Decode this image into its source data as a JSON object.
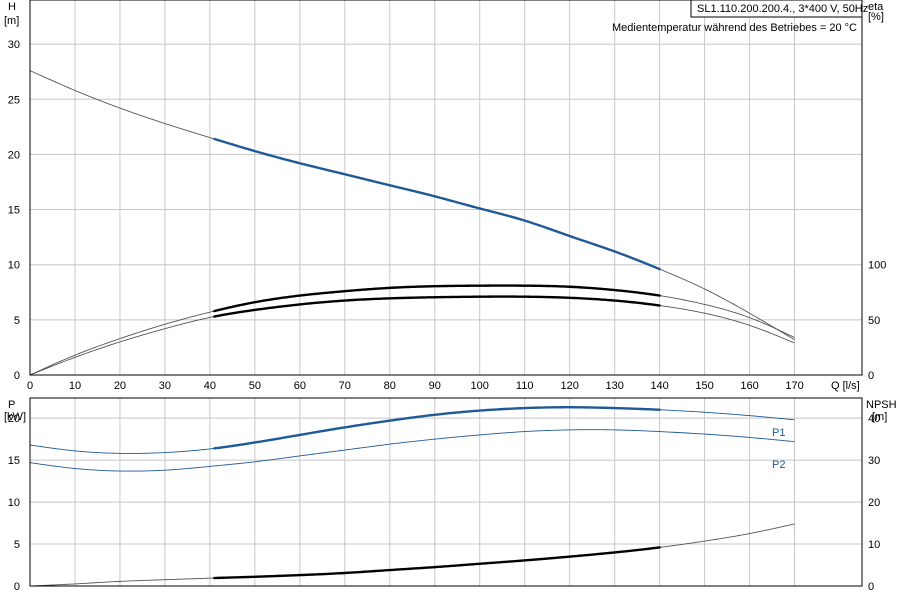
{
  "colors": {
    "blue": "#1f5a96",
    "black": "#000000",
    "thin": "#555555",
    "grid": "#c8c8c8"
  },
  "header": {
    "model": "SL1.110.200.200.4., 3*400 V, 50Hz",
    "temperature_note": "Medientemperatur während des Betriebes = 20 °C"
  },
  "chart_data": [
    {
      "type": "line",
      "panel": "top",
      "y_left_label": "H",
      "y_left_unit": "[m]",
      "y_right_label": "eta",
      "y_right_unit": "[%]",
      "x_label": "Q [l/s]",
      "xlim": [
        0,
        185
      ],
      "x_ticks": [
        0,
        10,
        20,
        30,
        40,
        50,
        60,
        70,
        80,
        90,
        100,
        110,
        120,
        130,
        140,
        150,
        160,
        170
      ],
      "ylim_left": [
        0,
        34
      ],
      "y_left_ticks": [
        0,
        5,
        10,
        15,
        20,
        25,
        30
      ],
      "ylim_right": [
        0,
        340
      ],
      "y_right_ticks": [
        0,
        50,
        100
      ],
      "grid": true,
      "series": [
        {
          "role": "H",
          "axis": "left",
          "style": "thin",
          "x": [
            0,
            10,
            20,
            30,
            41,
            50,
            60,
            70,
            80,
            90,
            100,
            110,
            120,
            130,
            140,
            150,
            160,
            170
          ],
          "y": [
            27.6,
            25.8,
            24.2,
            22.8,
            21.4,
            20.3,
            19.2,
            18.2,
            17.2,
            16.2,
            15.1,
            14.0,
            12.6,
            11.2,
            9.6,
            7.8,
            5.6,
            3.2
          ]
        },
        {
          "role": "H",
          "axis": "left",
          "style": "bold-blue",
          "x_start": 41,
          "x_end": 140
        },
        {
          "role": "eta-upper",
          "axis": "left",
          "style": "thin",
          "x": [
            0,
            10,
            20,
            30,
            41,
            50,
            60,
            70,
            80,
            90,
            100,
            110,
            120,
            130,
            140,
            150,
            160,
            170
          ],
          "y": [
            0,
            1.8,
            3.3,
            4.6,
            5.8,
            6.6,
            7.2,
            7.6,
            7.9,
            8.05,
            8.1,
            8.1,
            8.0,
            7.7,
            7.2,
            6.4,
            5.2,
            3.4
          ]
        },
        {
          "role": "eta-upper",
          "axis": "left",
          "style": "bold-black",
          "x_start": 41,
          "x_end": 140
        },
        {
          "role": "eta-lower",
          "axis": "left",
          "style": "thin",
          "x": [
            0,
            10,
            20,
            30,
            41,
            50,
            60,
            70,
            80,
            90,
            100,
            110,
            120,
            130,
            140,
            150,
            160,
            170
          ],
          "y": [
            0,
            1.6,
            3.0,
            4.2,
            5.3,
            5.9,
            6.4,
            6.75,
            6.95,
            7.05,
            7.1,
            7.1,
            7.0,
            6.75,
            6.3,
            5.6,
            4.5,
            2.9
          ]
        },
        {
          "role": "eta-lower",
          "axis": "left",
          "style": "bold-black",
          "x_start": 41,
          "x_end": 140
        }
      ]
    },
    {
      "type": "line",
      "panel": "bottom",
      "y_left_label": "P",
      "y_left_unit": "[kW]",
      "y_right_label": "NPSH",
      "y_right_unit": "[m]",
      "xlim": [
        0,
        185
      ],
      "ylim_left": [
        0,
        22.4
      ],
      "y_left_ticks": [
        0,
        5,
        10,
        15,
        20
      ],
      "ylim_right": [
        0,
        44.8
      ],
      "y_right_ticks": [
        0,
        10,
        20,
        30,
        40
      ],
      "grid": true,
      "series": [
        {
          "name": "P1",
          "axis": "left",
          "style": "thin-blue",
          "x": [
            0,
            10,
            20,
            30,
            41,
            50,
            60,
            70,
            80,
            90,
            100,
            110,
            120,
            130,
            140,
            150,
            160,
            170
          ],
          "y": [
            16.8,
            16.1,
            15.8,
            15.9,
            16.4,
            17.1,
            18.0,
            18.9,
            19.7,
            20.4,
            20.9,
            21.2,
            21.3,
            21.2,
            21.0,
            20.7,
            20.3,
            19.8
          ]
        },
        {
          "name": "P1",
          "axis": "left",
          "style": "bold-blue",
          "x_start": 41,
          "x_end": 140
        },
        {
          "name": "P2",
          "axis": "left",
          "style": "thin-blue",
          "x": [
            0,
            10,
            20,
            30,
            41,
            50,
            60,
            70,
            80,
            90,
            100,
            110,
            120,
            130,
            140,
            150,
            160,
            170
          ],
          "y": [
            14.7,
            14.0,
            13.7,
            13.8,
            14.3,
            14.8,
            15.5,
            16.2,
            16.9,
            17.5,
            18.0,
            18.4,
            18.6,
            18.6,
            18.4,
            18.1,
            17.7,
            17.2
          ]
        },
        {
          "name": "NPSH",
          "axis": "right",
          "style": "thin",
          "x": [
            0,
            10,
            20,
            30,
            41,
            50,
            60,
            70,
            80,
            90,
            100,
            110,
            120,
            130,
            140,
            150,
            160,
            170
          ],
          "y": [
            0,
            0.5,
            1.1,
            1.5,
            1.9,
            2.2,
            2.6,
            3.1,
            3.8,
            4.5,
            5.3,
            6.1,
            7.0,
            8.0,
            9.2,
            10.7,
            12.5,
            14.8
          ]
        },
        {
          "name": "NPSH",
          "axis": "right",
          "style": "bold-black",
          "x_start": 41,
          "x_end": 140
        }
      ]
    }
  ]
}
